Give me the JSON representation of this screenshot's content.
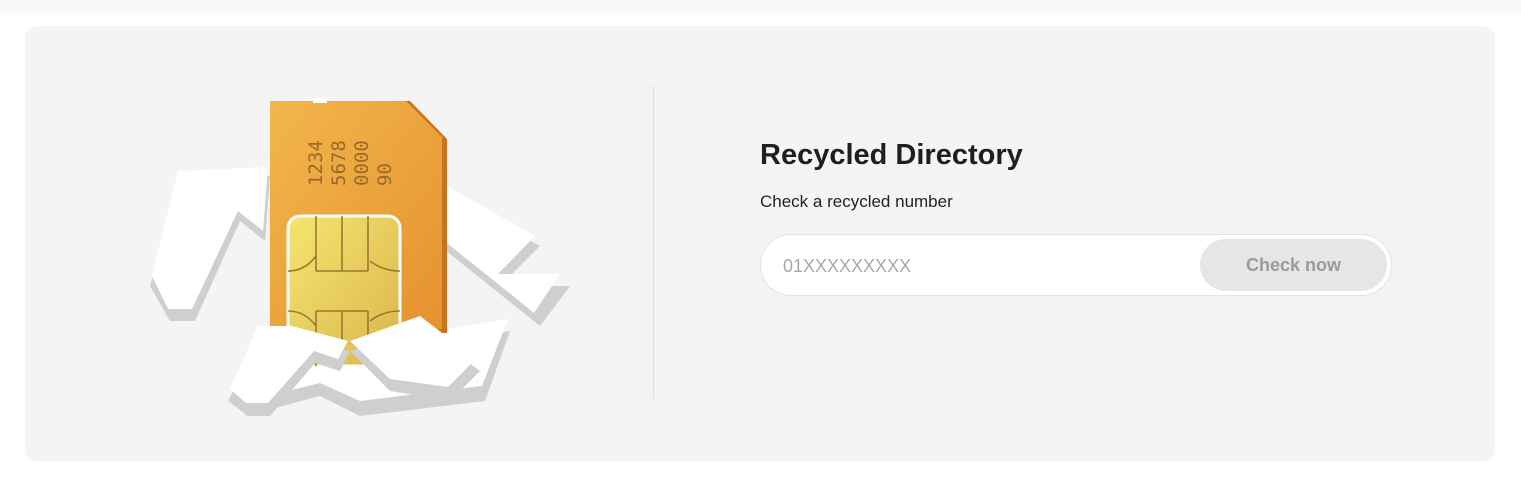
{
  "illustration": {
    "sim_card_digits": [
      "1234",
      "5678",
      "0000",
      "90"
    ],
    "card_color": "#ECA23A",
    "chip_color": "#EBD25F"
  },
  "directory": {
    "title": "Recycled Directory",
    "subtitle": "Check a recycled number",
    "input_placeholder": "01XXXXXXXXX",
    "input_value": "",
    "button_label": "Check now"
  },
  "colors": {
    "card_background": "#f4f4f4",
    "button_background": "#e6e6e6",
    "button_text": "#9a9a9a"
  }
}
